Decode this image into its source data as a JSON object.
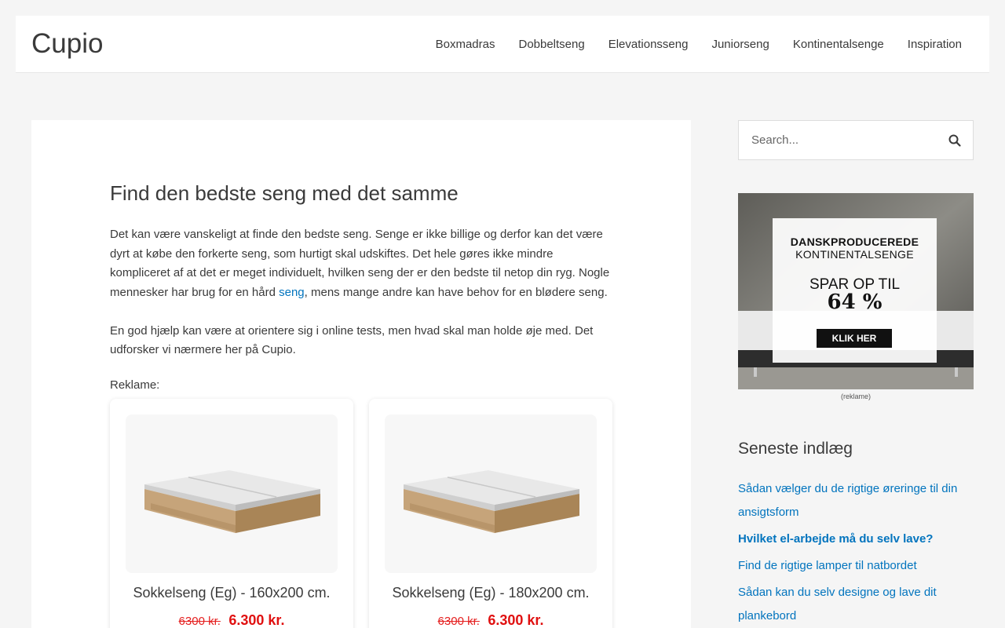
{
  "header": {
    "logo": "Cupio",
    "nav": [
      "Boxmadras",
      "Dobbeltseng",
      "Elevationsseng",
      "Juniorseng",
      "Kontinentalsenge",
      "Inspiration"
    ]
  },
  "article": {
    "title": "Find den bedste seng med det samme",
    "para1_before": "Det kan være vanskeligt at finde den bedste seng. Senge er ikke billige og derfor kan det være dyrt at købe den forkerte seng, som hurtigt skal udskiftes. Det hele gøres ikke mindre kompliceret af at det er meget individuelt, hvilken seng der er den bedste til netop din ryg. Nogle mennesker har brug for en hård ",
    "para1_link": "seng",
    "para1_after": ", mens mange andre kan have behov for en blødere seng.",
    "para2": "En god hjælp kan være at orientere sig i online tests, men hvad skal man holde øje med. Det udforsker vi nærmere her på Cupio.",
    "reklame_label": "Reklame:"
  },
  "products": [
    {
      "title": "Sokkelseng (Eg) - 160x200 cm.",
      "old_price": "6300 kr.",
      "new_price": "6.300 kr."
    },
    {
      "title": "Sokkelseng (Eg) - 180x200 cm.",
      "old_price": "6300 kr.",
      "new_price": "6.300 kr."
    }
  ],
  "sidebar": {
    "search_placeholder": "Search...",
    "ad": {
      "line1": "DANSKPRODUCEREDE",
      "line2": "KONTINENTALSENGE",
      "line3": "SPAR OP TIL",
      "line4": "64 %",
      "button": "KLIK HER",
      "caption": "(reklame)"
    },
    "recent_title": "Seneste indlæg",
    "recent_posts": [
      "Sådan vælger du de rigtige øreringe til din ansigtsform",
      "Hvilket el-arbejde må du selv lave?",
      "Find de rigtige lamper til natbordet",
      "Sådan kan du selv designe og lave dit plankebord"
    ]
  },
  "colors": {
    "link": "#0274be",
    "price": "#e01010",
    "background": "#f5f5f5"
  }
}
